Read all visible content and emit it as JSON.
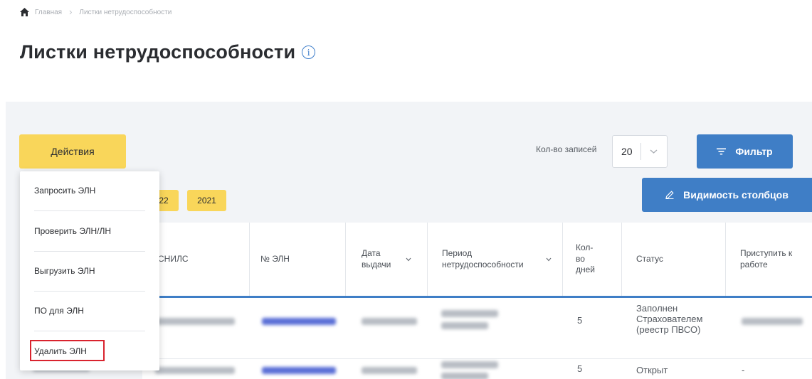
{
  "breadcrumb": {
    "home": "Главная",
    "current": "Листки нетрудоспособности"
  },
  "page": {
    "title": "Листки нетрудоспособности"
  },
  "toolbar": {
    "actions_label": "Действия",
    "count_label": "Кол-во записей",
    "count_value": "20",
    "filter_label": "Фильтр",
    "columns_label": "Видимость столбцов"
  },
  "year_chips": [
    "22",
    "2021"
  ],
  "actions_menu": {
    "items": [
      "Запросить ЭЛН",
      "Проверить ЭЛН/ЛН",
      "Выгрузить ЭЛН",
      "ПО для ЭЛН",
      "Удалить ЭЛН"
    ],
    "highlighted": "Удалить ЭЛН"
  },
  "table": {
    "headers": {
      "snils": "СНИЛС",
      "eln_number": "№ ЭЛН",
      "issue_date": "Дата выдачи",
      "period": "Период нетрудоспособности",
      "days": "Кол-во дней",
      "status": "Статус",
      "return": "Приступить к работе"
    },
    "rows": [
      {
        "days": "5",
        "status": "Заполнен Страхователем (реестр ПВСО)"
      },
      {
        "days": "5",
        "status": "Открыт",
        "return": "-"
      }
    ]
  },
  "colors": {
    "accent_yellow": "#f9d65a",
    "accent_blue": "#3f7ec6",
    "highlight_red": "#d9232e"
  },
  "icons": [
    "home-icon",
    "info-icon",
    "chevron-down-icon",
    "filter-icon",
    "pencil-icon"
  ]
}
